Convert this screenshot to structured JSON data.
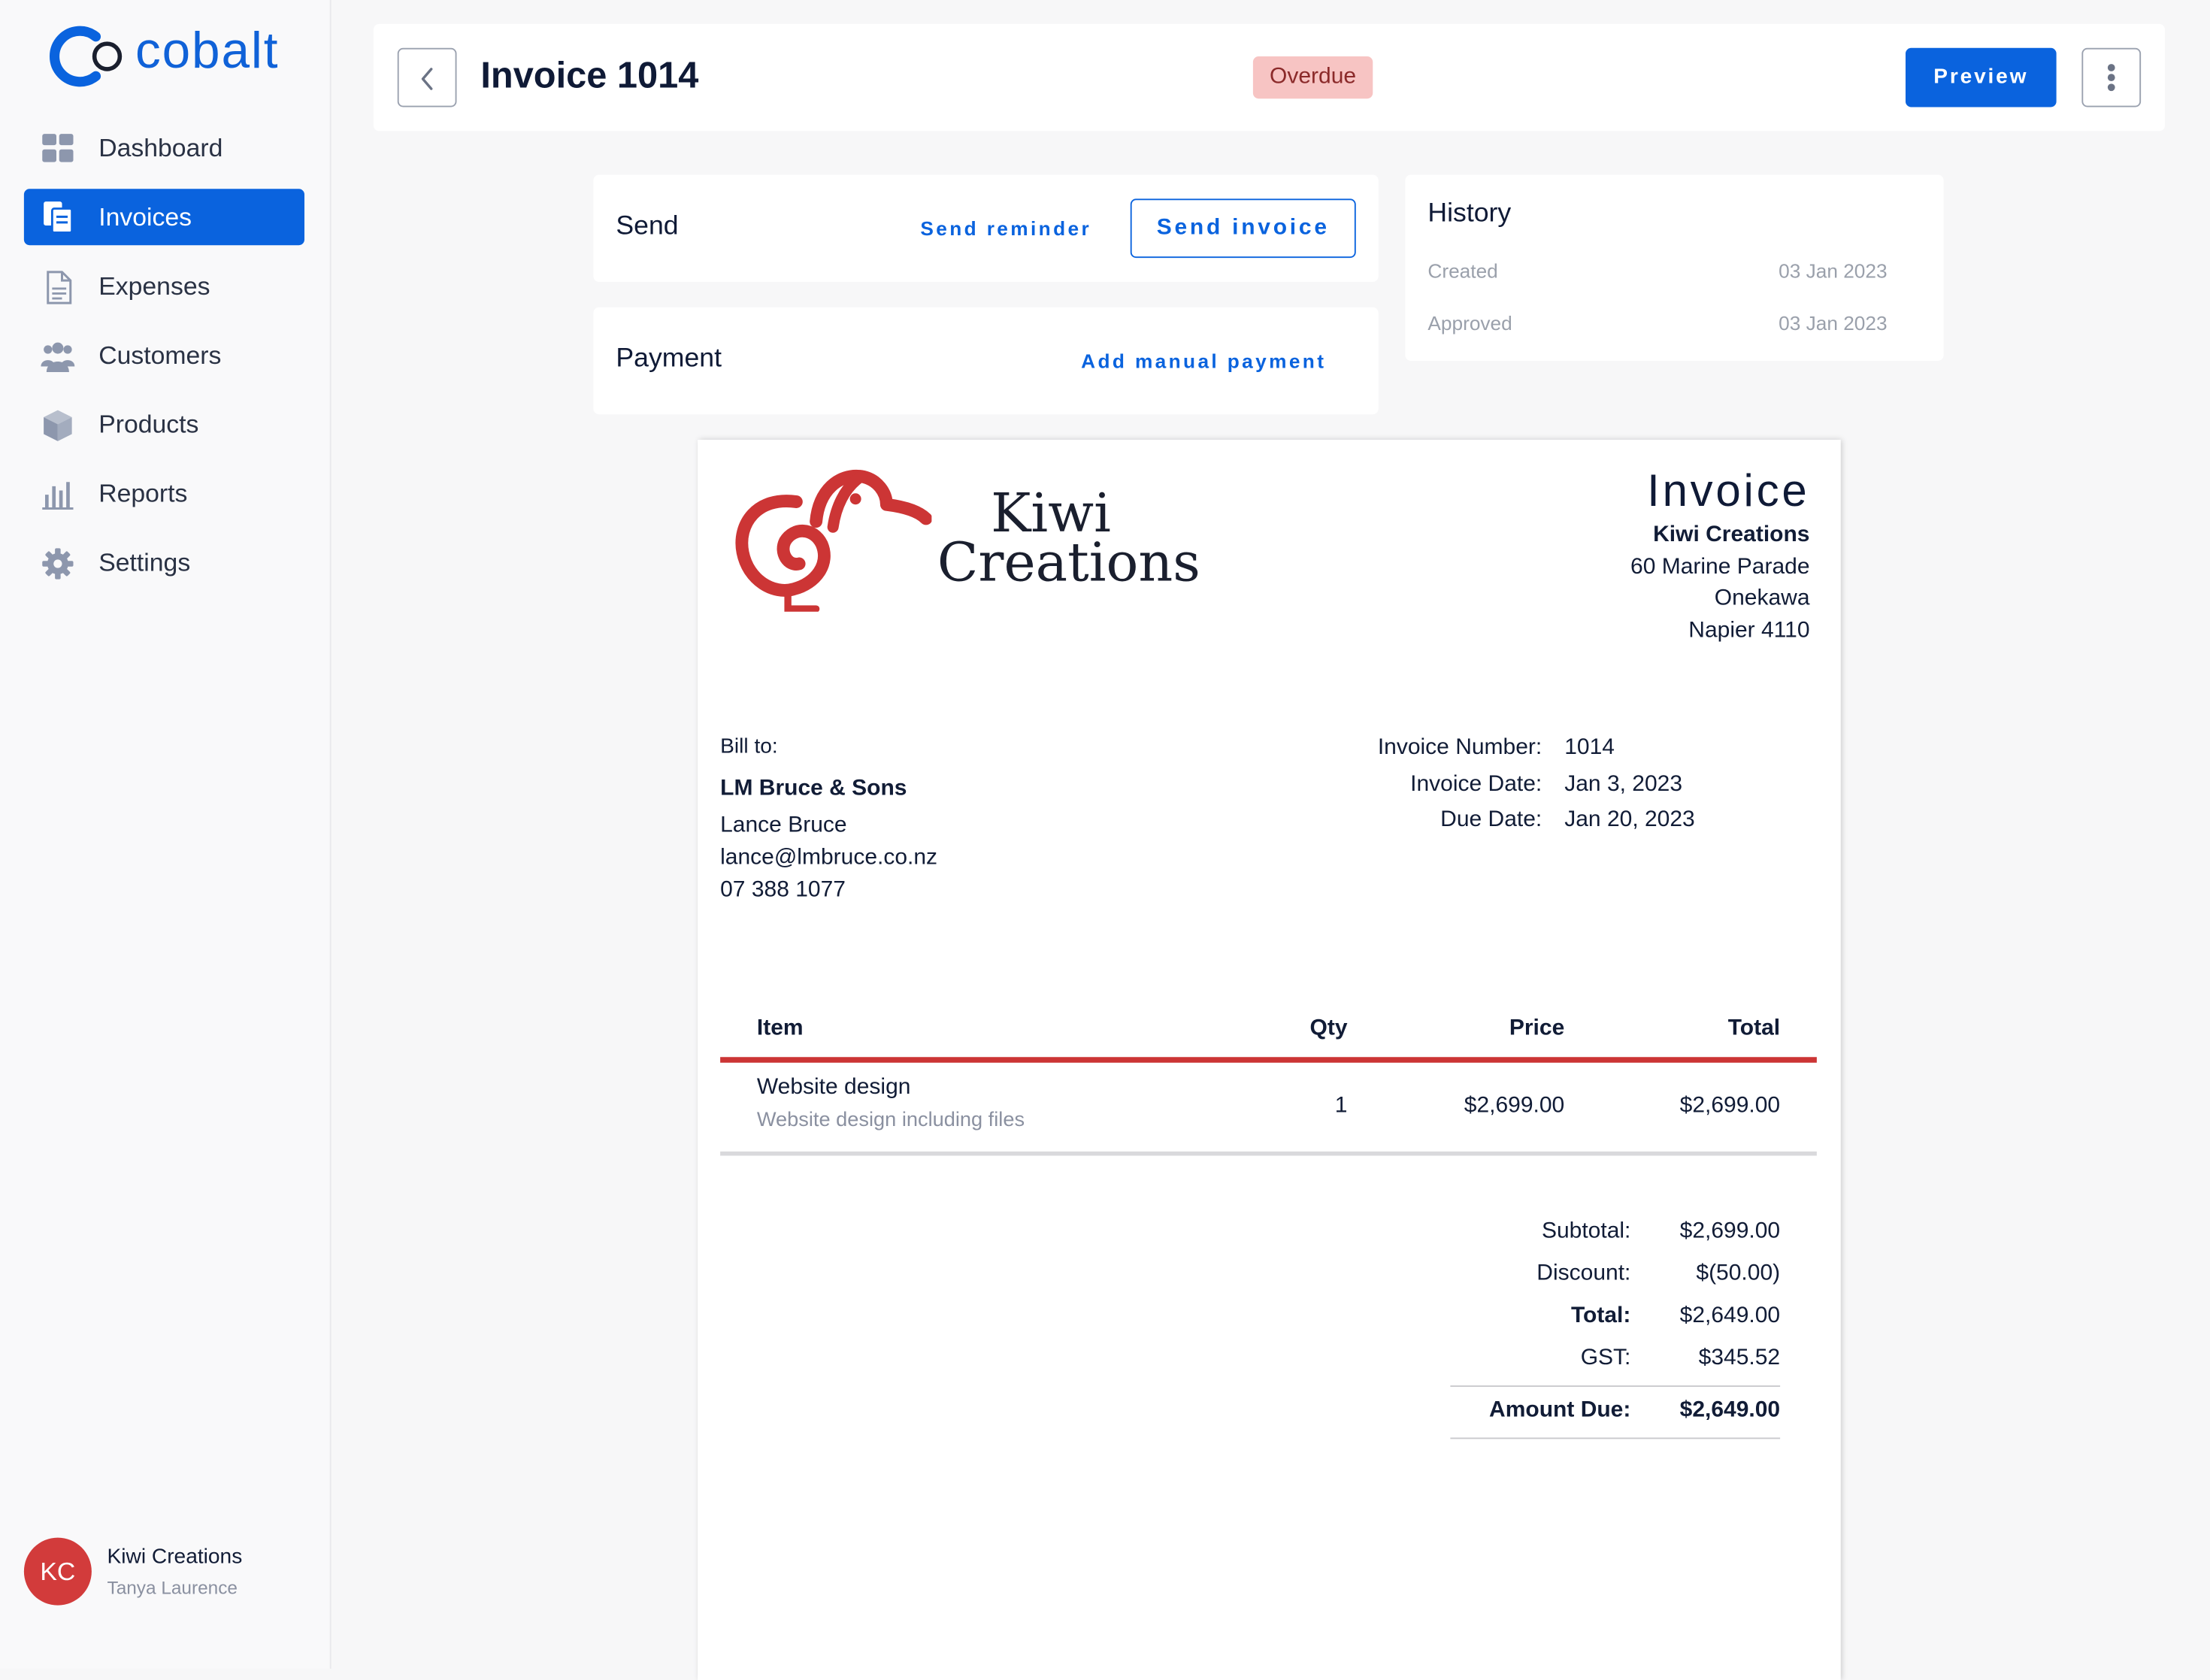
{
  "app": {
    "logo_text": "cobalt",
    "brand_color": "#0a63de"
  },
  "sidebar": {
    "items": [
      {
        "label": "Dashboard",
        "icon": "dashboard-icon"
      },
      {
        "label": "Invoices",
        "icon": "invoice-icon",
        "active": true
      },
      {
        "label": "Expenses",
        "icon": "document-icon"
      },
      {
        "label": "Customers",
        "icon": "users-icon"
      },
      {
        "label": "Products",
        "icon": "box-icon"
      },
      {
        "label": "Reports",
        "icon": "bar-chart-icon"
      },
      {
        "label": "Settings",
        "icon": "gear-icon"
      }
    ],
    "user": {
      "initials": "KC",
      "name": "Kiwi Creations",
      "sub": "Tanya Laurence"
    }
  },
  "header": {
    "title": "Invoice 1014",
    "status": "Overdue",
    "preview_label": "Preview"
  },
  "send_card": {
    "title": "Send",
    "reminder_label": "Send reminder",
    "send_label": "Send invoice"
  },
  "payment_card": {
    "title": "Payment",
    "add_label": "Add manual payment"
  },
  "history": {
    "title": "History",
    "rows": [
      {
        "label": "Created",
        "date": "03 Jan 2023"
      },
      {
        "label": "Approved",
        "date": "03 Jan 2023"
      }
    ]
  },
  "invoice": {
    "logo_word1": "Kiwi",
    "logo_word2": "Creations",
    "heading": "Invoice",
    "company": "Kiwi Creations",
    "address": [
      "60 Marine Parade",
      "Onekawa",
      "Napier 4110"
    ],
    "bill_to_label": "Bill to:",
    "customer": {
      "company": "LM Bruce & Sons",
      "name": "Lance Bruce",
      "email": "lance@lmbruce.co.nz",
      "phone": "07 388 1077"
    },
    "meta": [
      {
        "label": "Invoice Number:",
        "value": "1014"
      },
      {
        "label": "Invoice Date:",
        "value": "Jan 3, 2023"
      },
      {
        "label": "Due Date:",
        "value": "Jan 20, 2023"
      }
    ],
    "columns": {
      "item": "Item",
      "qty": "Qty",
      "price": "Price",
      "total": "Total"
    },
    "lines": [
      {
        "name": "Website design",
        "desc": "Website design including files",
        "qty": "1",
        "price": "$2,699.00",
        "total": "$2,699.00"
      }
    ],
    "totals": [
      {
        "label": "Subtotal:",
        "value": "$2,699.00"
      },
      {
        "label": "Discount:",
        "value": "$(50.00)"
      },
      {
        "label": "Total:",
        "value": "$2,649.00"
      },
      {
        "label": "GST:",
        "value": "$345.52"
      }
    ],
    "amount_due": {
      "label": "Amount Due:",
      "value": "$2,649.00"
    },
    "accent_color": "#cc3535"
  }
}
